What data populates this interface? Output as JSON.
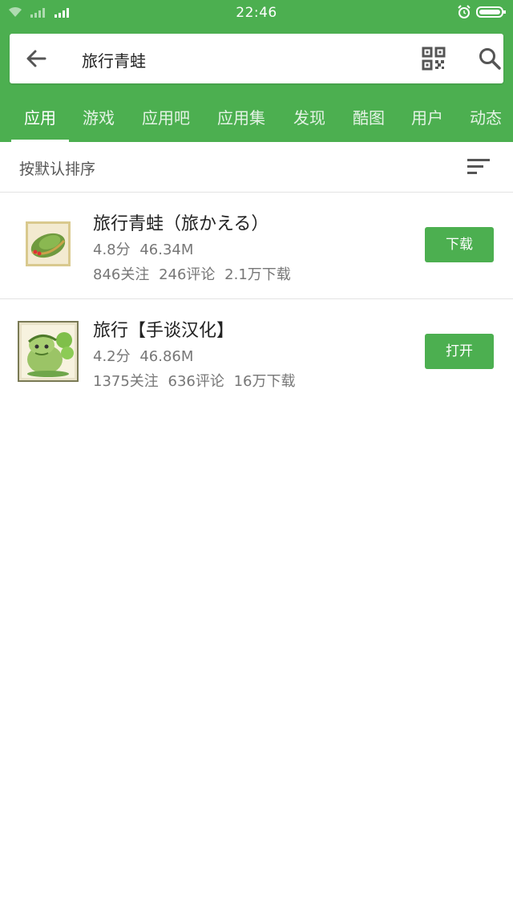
{
  "status_bar": {
    "time": "22:46"
  },
  "search": {
    "query": "旅行青蛙"
  },
  "tabs": [
    {
      "label": "应用",
      "active": true
    },
    {
      "label": "游戏"
    },
    {
      "label": "应用吧"
    },
    {
      "label": "应用集"
    },
    {
      "label": "发现"
    },
    {
      "label": "酷图"
    },
    {
      "label": "用户"
    },
    {
      "label": "动态"
    }
  ],
  "sort": {
    "label": "按默认排序"
  },
  "apps": [
    {
      "name": "旅行青蛙（旅かえる）",
      "meta": "4.8分 46.34M",
      "stats": "846关注 246评论 2.1万下载",
      "action": "下载"
    },
    {
      "name": "旅行【手谈汉化】",
      "meta": "4.2分 46.86M",
      "stats": "1375关注 636评论 16万下载",
      "action": "打开"
    }
  ],
  "colors": {
    "accent": "#4caf50"
  }
}
